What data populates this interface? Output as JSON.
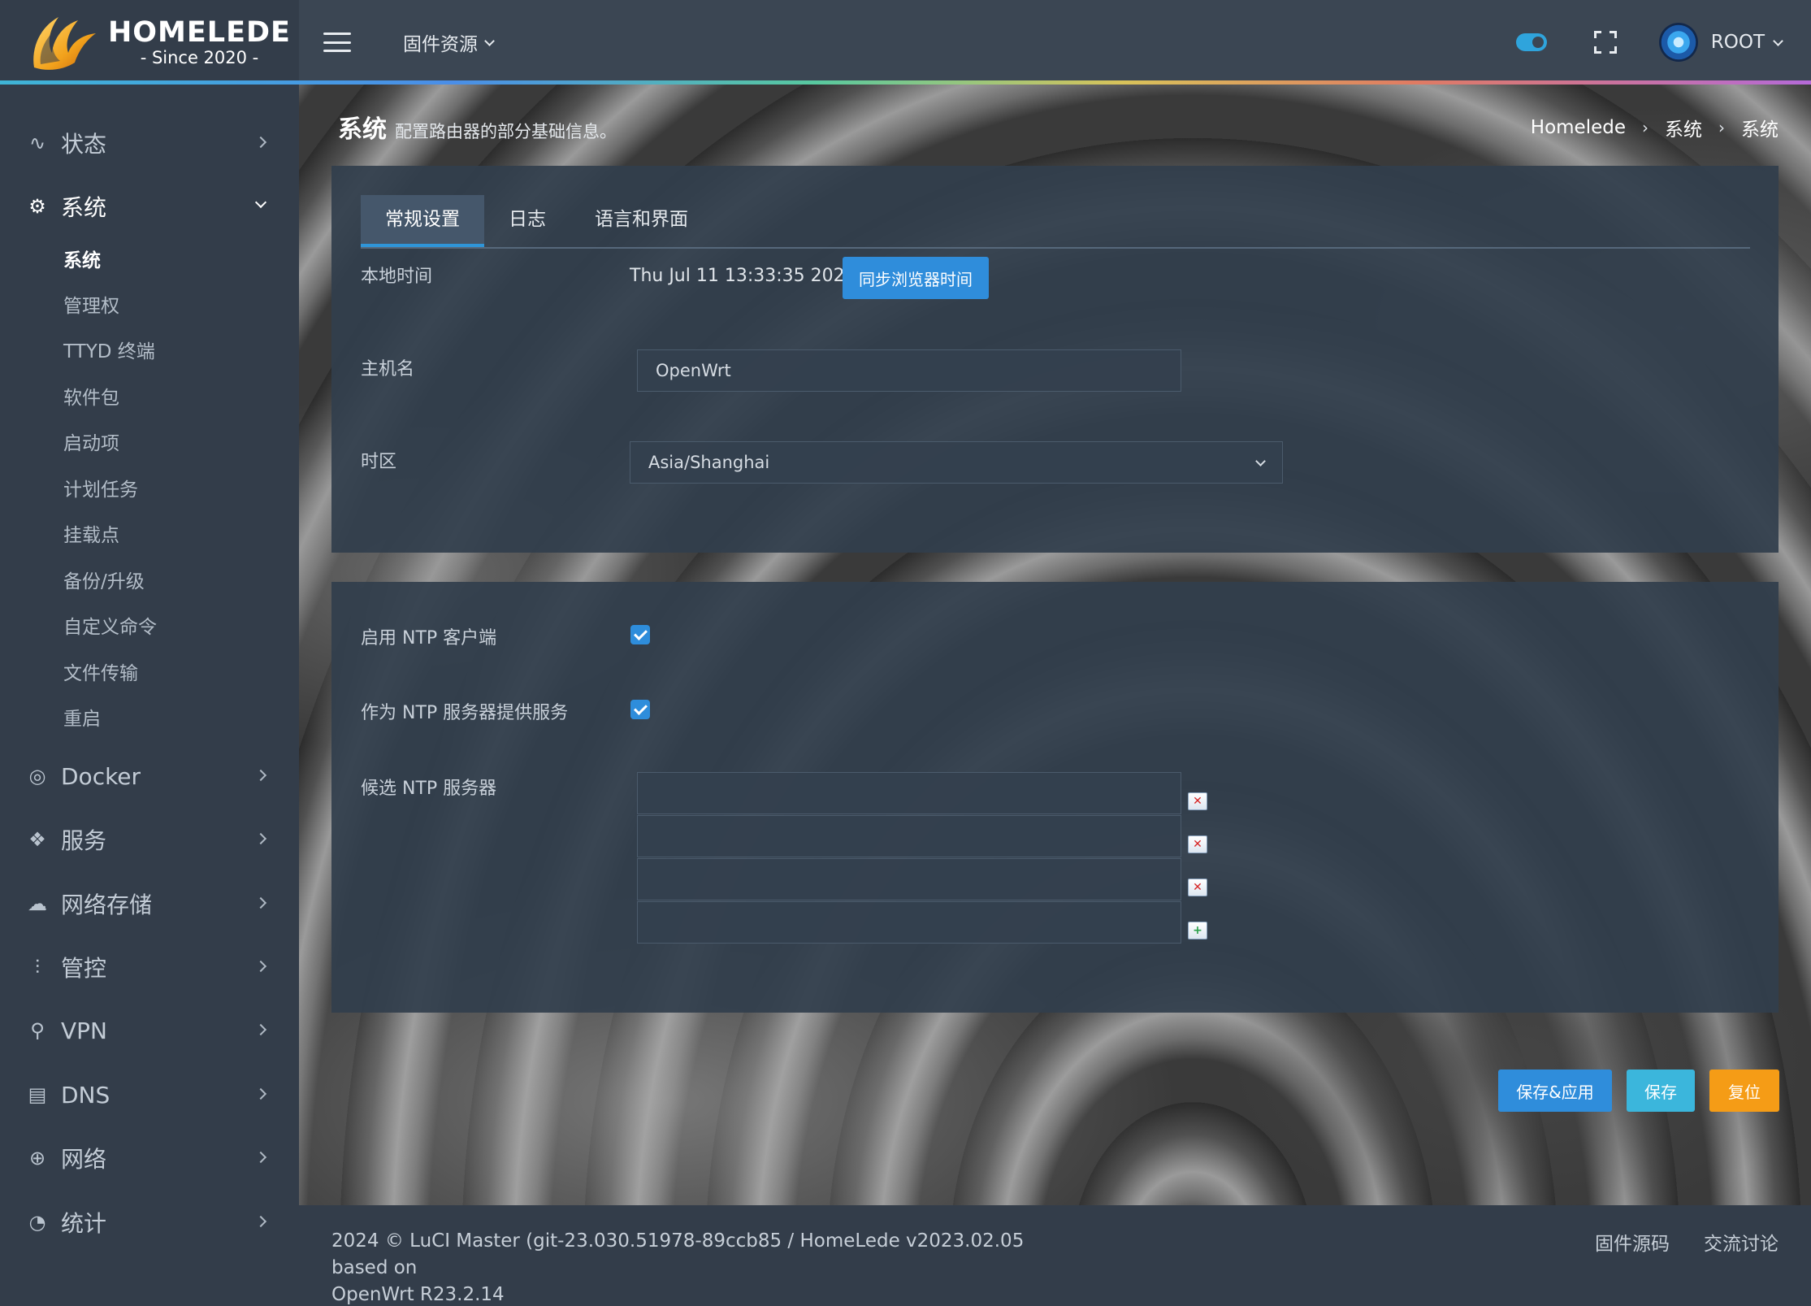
{
  "brand": {
    "name": "HOMELEDE",
    "since": "- Since 2020 -"
  },
  "header": {
    "firmware_menu": "固件资源",
    "user": "ROOT"
  },
  "sidebar": {
    "items": [
      {
        "label": "状态",
        "icon": "activity-icon"
      },
      {
        "label": "系统",
        "icon": "gear-icon"
      },
      {
        "label": "Docker",
        "icon": "docker-icon"
      },
      {
        "label": "服务",
        "icon": "services-icon"
      },
      {
        "label": "网络存储",
        "icon": "cloud-storage-icon"
      },
      {
        "label": "管控",
        "icon": "sliders-icon"
      },
      {
        "label": "VPN",
        "icon": "vpn-icon"
      },
      {
        "label": "DNS",
        "icon": "dns-icon"
      },
      {
        "label": "网络",
        "icon": "globe-icon"
      },
      {
        "label": "统计",
        "icon": "stats-icon"
      }
    ],
    "system_sub": [
      "系统",
      "管理权",
      "TTYD 终端",
      "软件包",
      "启动项",
      "计划任务",
      "挂载点",
      "备份/升级",
      "自定义命令",
      "文件传输",
      "重启"
    ]
  },
  "page": {
    "title": "系统",
    "description": "配置路由器的部分基础信息。",
    "breadcrumb": [
      "Homelede",
      "系统",
      "系统"
    ]
  },
  "tabs": [
    "常规设置",
    "日志",
    "语言和界面"
  ],
  "general": {
    "local_time_label": "本地时间",
    "local_time_value": "Thu Jul 11 13:33:35 2024",
    "sync_button": "同步浏览器时间",
    "hostname_label": "主机名",
    "hostname_value": "OpenWrt",
    "timezone_label": "时区",
    "timezone_value": "Asia/Shanghai"
  },
  "ntp": {
    "enable_client_label": "启用 NTP 客户端",
    "enable_client": true,
    "serve_label": "作为 NTP 服务器提供服务",
    "serve": true,
    "servers_label": "候选 NTP 服务器",
    "servers": [
      "",
      "",
      "",
      ""
    ]
  },
  "actions": {
    "save_apply": "保存&应用",
    "save": "保存",
    "reset": "复位"
  },
  "footer": {
    "copyright_line1": "2024 © LuCI Master (git-23.030.51978-89ccb85 / HomeLede v2023.02.05 based on",
    "copyright_line2": "OpenWrt R23.2.14",
    "links": [
      "固件源码",
      "交流讨论"
    ]
  },
  "colors": {
    "accent": "#2f8ddb",
    "save": "#3bb6dc",
    "reset": "#f59c16",
    "sidebar": "#333d4a",
    "header": "#3b4653"
  }
}
